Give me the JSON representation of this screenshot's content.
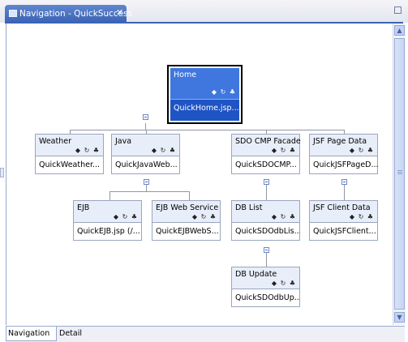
{
  "window": {
    "tab_title": "Navigation - QuickSuccess",
    "close_glyph": "✕",
    "maximize_glyph": "maximize-icon"
  },
  "scrollbar": {
    "up_glyph": "▲",
    "down_glyph": "▼"
  },
  "colors": {
    "accent": "#3c63b5",
    "selected_node": "#3f77de",
    "node_header": "#e8eef9",
    "connector": "#8f96a6"
  },
  "nodes": {
    "home": {
      "title": "Home",
      "file": "QuickHome.jsp..."
    },
    "weather": {
      "title": "Weather",
      "file": "QuickWeather..."
    },
    "java": {
      "title": "Java",
      "file": "QuickJavaWeb..."
    },
    "sdo_cmp": {
      "title": "SDO CMP Facade",
      "file": "QuickSDOCMP..."
    },
    "jsf_page": {
      "title": "JSF Page Data",
      "file": "QuickJSFPageD..."
    },
    "ejb": {
      "title": "EJB",
      "file": "QuickEJB.jsp (/..."
    },
    "ejb_ws": {
      "title": "EJB Web Service",
      "file": "QuickEJBWebS..."
    },
    "db_list": {
      "title": "DB List",
      "file": "QuickSDOdbLis..."
    },
    "jsf_client": {
      "title": "JSF Client Data",
      "file": "QuickJSFClient..."
    },
    "db_update": {
      "title": "DB Update",
      "file": "QuickSDOdbUp..."
    }
  },
  "node_icons": "◆ ↻ ♣",
  "bottom_tabs": {
    "navigation": "Navigation",
    "detail": "Detail"
  }
}
